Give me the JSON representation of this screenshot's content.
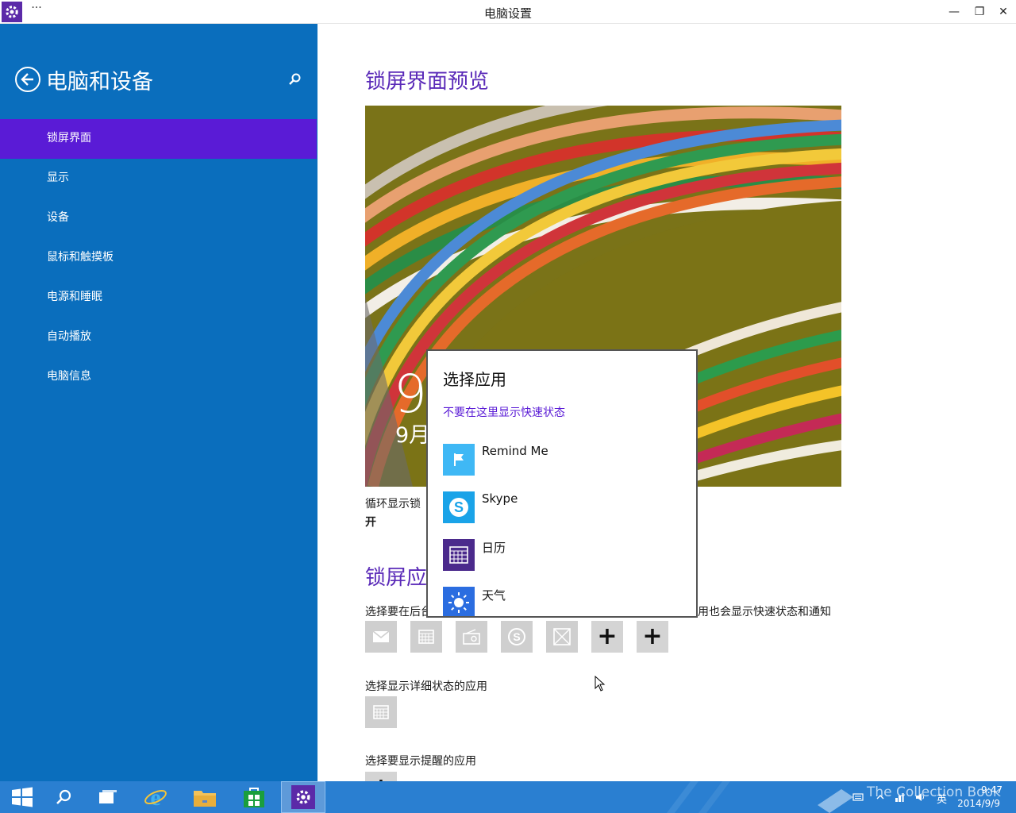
{
  "window": {
    "title": "电脑设置",
    "more_glyph": "···",
    "minimize_glyph": "—",
    "restore_glyph": "❐",
    "close_glyph": "✕"
  },
  "sidebar": {
    "title": "电脑和设备",
    "items": [
      {
        "label": "锁屏界面",
        "active": true
      },
      {
        "label": "显示"
      },
      {
        "label": "设备"
      },
      {
        "label": "鼠标和触摸板"
      },
      {
        "label": "电源和睡眠"
      },
      {
        "label": "自动播放"
      },
      {
        "label": "电脑信息"
      }
    ]
  },
  "main": {
    "preview_heading": "锁屏界面预览",
    "preview_time": "9",
    "preview_date": "9月",
    "slideshow_label": "循环显示锁",
    "slideshow_value": "开",
    "lockapps_heading": "锁屏应",
    "quick_status_label_left": "选择要在后台",
    "quick_status_label_right": "用也会显示快速状态和通知",
    "detailed_status_label": "选择显示详细状态的应用",
    "alarm_label": "选择要显示提醒的应用",
    "plus_glyph": "+"
  },
  "popup": {
    "title": "选择应用",
    "none_option": "不要在这里显示快速状态",
    "apps": [
      {
        "name": "Remind Me",
        "icon": "flag-icon",
        "color": "#3fb8f5"
      },
      {
        "name": "Skype",
        "icon": "skype-icon",
        "color": "#1aa3e8"
      },
      {
        "name": "日历",
        "icon": "calendar-icon",
        "color": "#4b2a8c"
      },
      {
        "name": "天气",
        "icon": "sun-icon",
        "color": "#2b6de0"
      }
    ]
  },
  "taskbar": {
    "watermark": "The Collection Book",
    "time": "9:47",
    "date": "2014/9/9",
    "language": "英"
  },
  "colors": {
    "sidebar": "#0a6ebd",
    "active_nav": "#5a1bd6",
    "heading": "#5a2ab8",
    "taskbar": "#2a7fd1"
  }
}
